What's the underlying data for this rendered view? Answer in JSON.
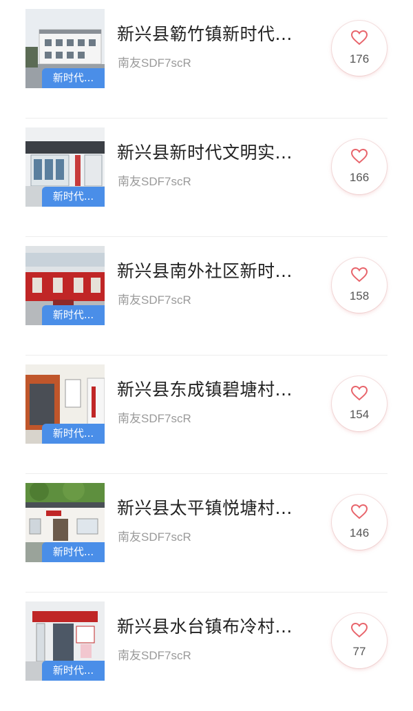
{
  "items": [
    {
      "title": "新兴县簕竹镇新时代...",
      "author": "南友SDF7scR",
      "tag": "新时代...",
      "likes": "176"
    },
    {
      "title": "新兴县新时代文明实...",
      "author": "南友SDF7scR",
      "tag": "新时代...",
      "likes": "166"
    },
    {
      "title": "新兴县南外社区新时...",
      "author": "南友SDF7scR",
      "tag": "新时代...",
      "likes": "158"
    },
    {
      "title": "新兴县东成镇碧塘村...",
      "author": "南友SDF7scR",
      "tag": "新时代...",
      "likes": "154"
    },
    {
      "title": "新兴县太平镇悦塘村...",
      "author": "南友SDF7scR",
      "tag": "新时代...",
      "likes": "146"
    },
    {
      "title": "新兴县水台镇布冷村...",
      "author": "南友SDF7scR",
      "tag": "新时代...",
      "likes": "77"
    }
  ],
  "icons": {
    "like": "heart-outline-icon"
  },
  "colors": {
    "tag_bg": "#4a8ee8",
    "heart": "#e8646b",
    "title": "#222222",
    "author": "#9a9a9a"
  }
}
